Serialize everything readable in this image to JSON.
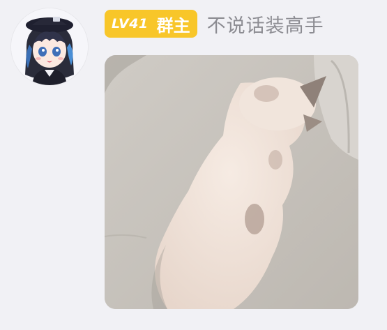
{
  "message": {
    "sender": {
      "level": "LV41",
      "role": "群主",
      "nickname": "不说话装高手",
      "avatar_icon": "anime-girl-avatar-icon"
    },
    "content": {
      "type": "image",
      "image_icon": "sleeping-cat-photo"
    }
  },
  "colors": {
    "background": "#f1f1f5",
    "badge": "#f8c629",
    "badge_text": "#ffffff",
    "nickname": "#8c8c92"
  }
}
